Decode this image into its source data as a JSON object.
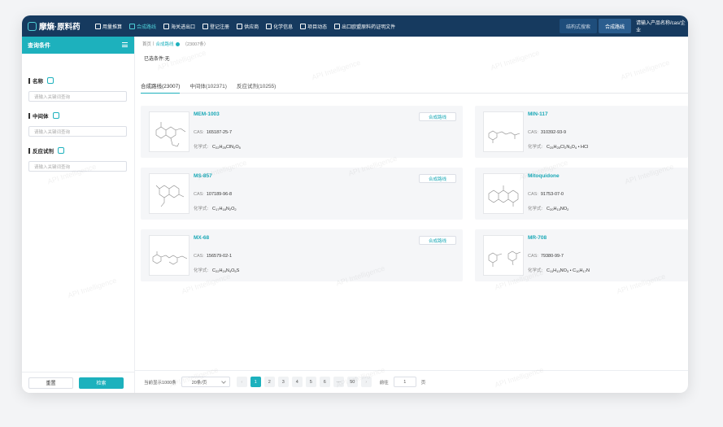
{
  "app": {
    "logo": "摩熵·原料药"
  },
  "nav": {
    "items": [
      {
        "label": "用量推算",
        "active": false
      },
      {
        "label": "合成路线",
        "active": true
      },
      {
        "label": "海关进出口",
        "active": false
      },
      {
        "label": "登记注册",
        "active": false
      },
      {
        "label": "供应商",
        "active": false
      },
      {
        "label": "化学信息",
        "active": false
      },
      {
        "label": "项目动态",
        "active": false
      },
      {
        "label": "出口欧盟原料药证明文件",
        "active": false
      }
    ],
    "structure_search": "结构式搜索",
    "route_tab": "合成路线",
    "search_placeholder": "请输入产品名称/cas/企业"
  },
  "sidebar": {
    "title": "查询条件",
    "fields": [
      {
        "label": "名称",
        "placeholder": "请输入关键词查询"
      },
      {
        "label": "中间体",
        "placeholder": "请输入关键词查询"
      },
      {
        "label": "反应试剂",
        "placeholder": "请输入关键词查询"
      }
    ],
    "reset": "重置",
    "search": "检索"
  },
  "breadcrumb": {
    "home": "首页",
    "sep": "|",
    "current": "合成路线",
    "count": "（23007条）"
  },
  "conditions": "已选条件:无",
  "tabs": [
    {
      "label": "合成路线(23007)",
      "active": true
    },
    {
      "label": "中间体(102371)",
      "active": false
    },
    {
      "label": "反应试剂(10255)",
      "active": false
    }
  ],
  "cas_label": "CAS:",
  "formula_label": "化学式:",
  "route_button": "合成路线",
  "cards": [
    {
      "name": "MEM-1003",
      "cas": "165187-25-7",
      "formula": [
        "C",
        "22",
        "H",
        "25",
        "ClN",
        "2",
        "O",
        "5"
      ],
      "route": true
    },
    {
      "name": "MIN-117",
      "cas": "310392-93-9",
      "formula": [
        "C",
        "25",
        "H",
        "25",
        "Cl",
        "2",
        "N",
        "3",
        "O",
        "4",
        " • HCl",
        ""
      ],
      "route": false
    },
    {
      "name": "MS-857",
      "cas": "107189-96-8",
      "formula": [
        "C",
        "17",
        "H",
        "18",
        "N",
        "2",
        "O",
        "2"
      ],
      "route": true
    },
    {
      "name": "Mitoquidone",
      "cas": "91753-07-0",
      "formula": [
        "C",
        "20",
        "H",
        "13",
        "NO",
        "2"
      ],
      "route": false
    },
    {
      "name": "MX-68",
      "cas": "156579-02-1",
      "formula": [
        "C",
        "22",
        "H",
        "24",
        "N",
        "4",
        "O",
        "5",
        "S",
        ""
      ],
      "route": true
    },
    {
      "name": "MR-708",
      "cas": "79380-99-7",
      "formula": [
        "C",
        "11",
        "H",
        "13",
        "NO",
        "3",
        " • C",
        "10",
        "H",
        "17",
        "N",
        ""
      ],
      "route": false
    }
  ],
  "pager": {
    "total": "当前显示1000条",
    "page_size": "20条/页",
    "prev": "‹",
    "next": "›",
    "pages": [
      "1",
      "2",
      "3",
      "4",
      "5",
      "6",
      "···",
      "50"
    ],
    "active_page": "1",
    "goto": "前往",
    "goto_value": "1",
    "page_unit": "页"
  },
  "watermark": "API Intelligence"
}
